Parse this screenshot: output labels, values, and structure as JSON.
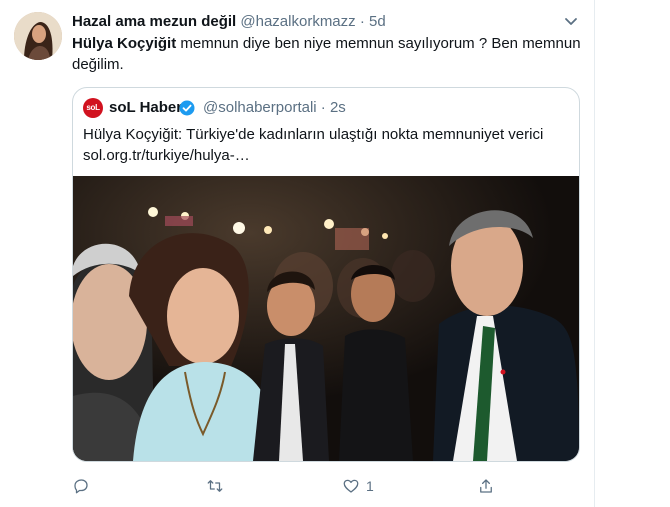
{
  "tweet": {
    "author_name": "Hazal ama mezun değil",
    "author_handle": "@hazalkorkmazz",
    "separator": "·",
    "time": "5d",
    "text_bold": "Hülya Koçyiğit",
    "text_rest": " memnun diye ben niye memnun sayılıyorum ? Ben memnun değilim.",
    "avatar_icon": "user-avatar-photo",
    "menu_icon": "chevron-down-icon"
  },
  "quoted_tweet": {
    "logo_text": "soL",
    "author_name": "soL Haber",
    "verified_icon": "verified-badge-icon",
    "author_handle": "@solhaberportali",
    "separator": "·",
    "time": "2s",
    "text_line1": "Hülya Koçyiğit: Türkiye'de kadınların ulaştığı nokta memnuniyet verici",
    "text_line2": "sol.org.tr/turkiye/hulya-…",
    "photo_icon": "news-photo"
  },
  "actions": {
    "reply_icon": "reply-icon",
    "retweet_icon": "retweet-icon",
    "like_icon": "heart-icon",
    "like_count": "1",
    "share_icon": "share-icon"
  },
  "colors": {
    "text": "#0f1419",
    "secondary": "#5b7083",
    "border": "#cfd9de",
    "verified": "#1d9bf0",
    "brand_red": "#d1121f"
  }
}
